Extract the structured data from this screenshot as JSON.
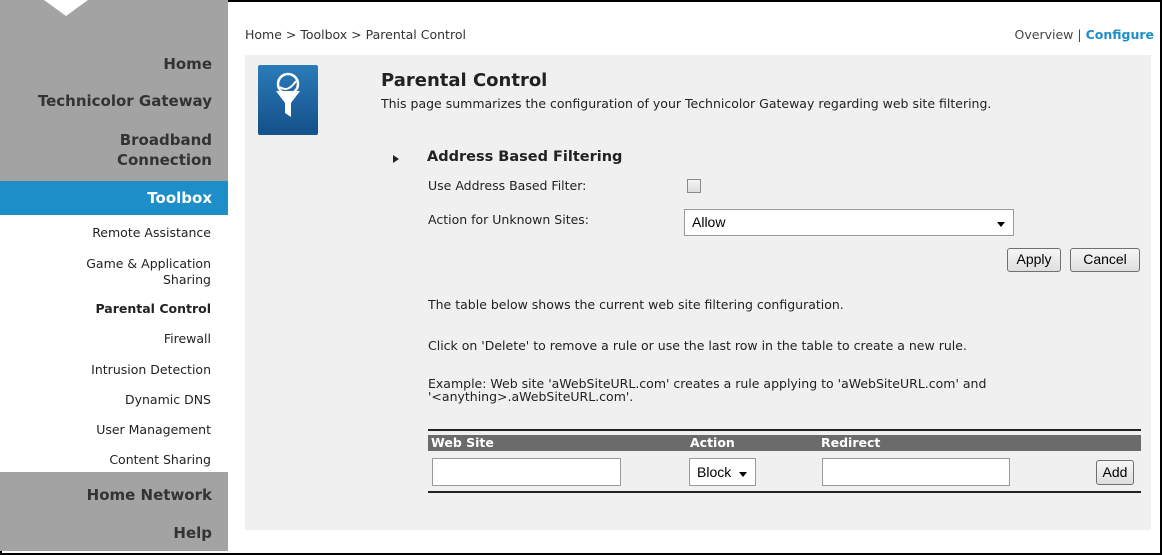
{
  "sidebar": {
    "main_items": [
      {
        "label": "Home"
      },
      {
        "label": "Technicolor Gateway"
      },
      {
        "label": "Broadband",
        "label2": "Connection"
      },
      {
        "label": "Toolbox"
      },
      {
        "label": "Home Network"
      },
      {
        "label": "Help"
      }
    ],
    "sub_items": [
      {
        "label": "Remote Assistance"
      },
      {
        "label": "Game & Application",
        "label2": "Sharing"
      },
      {
        "label": "Parental Control"
      },
      {
        "label": "Firewall"
      },
      {
        "label": "Intrusion Detection"
      },
      {
        "label": "Dynamic DNS"
      },
      {
        "label": "User Management"
      },
      {
        "label": "Content Sharing"
      }
    ]
  },
  "header": {
    "breadcrumb": "Home > Toolbox > Parental Control",
    "overview": "Overview",
    "separator": " | ",
    "configure": "Configure"
  },
  "page": {
    "icon": "parental-control-filter-icon",
    "title": "Parental Control",
    "subtitle": "This page summarizes the configuration of your Technicolor Gateway regarding web site filtering.",
    "section_title": "Address Based Filtering",
    "use_filter_label": "Use Address Based Filter:",
    "use_filter_checked": false,
    "unknown_sites_label": "Action for Unknown Sites:",
    "unknown_sites_value": "Allow",
    "apply": "Apply",
    "cancel": "Cancel",
    "info1": "The table below shows the current web site filtering configuration.",
    "info2": "Click on 'Delete' to remove a rule or use the last row in the table to create a new rule.",
    "info3a": "Example: Web site 'aWebSiteURL.com' creates a rule applying to 'aWebSiteURL.com' and",
    "info3b": "'<anything>.aWebSiteURL.com'."
  },
  "table": {
    "columns": [
      "Web Site",
      "Action",
      "Redirect"
    ],
    "new_row": {
      "web_site": "",
      "action": "Block",
      "redirect": "",
      "add": "Add"
    }
  },
  "colors": {
    "accent": "#1e8ec9",
    "sidebar": "#a3a3a3",
    "panel": "#f0f0f0",
    "table_header": "#6b6b6b"
  }
}
